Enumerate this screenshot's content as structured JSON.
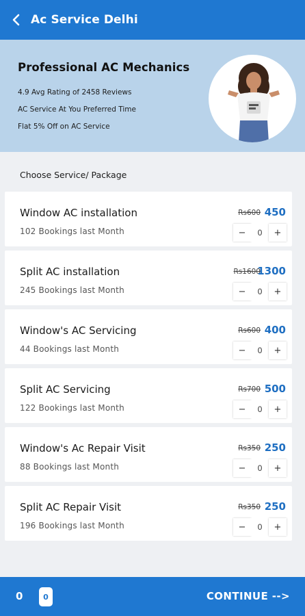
{
  "header": {
    "title": "Ac Service Delhi"
  },
  "hero": {
    "heading": "Professional AC Mechanics",
    "lines": [
      "4.9 Avg Rating of 2458 Reviews",
      "AC Service At You Preferred Time",
      "Flat 5% Off on AC Service"
    ]
  },
  "section_label": "Choose Service/ Package",
  "services": [
    {
      "name": "Window AC installation",
      "bookings": "102  Bookings  last Month",
      "old_price": "Rs600",
      "price": "450",
      "qty": "0"
    },
    {
      "name": "Split AC installation",
      "bookings": "245  Bookings  last Month",
      "old_price": "Rs1600",
      "price": "1300",
      "qty": "0"
    },
    {
      "name": "Window's AC Servicing",
      "bookings": "44  Bookings  last Month",
      "old_price": "Rs600",
      "price": "400",
      "qty": "0"
    },
    {
      "name": "Split AC Servicing",
      "bookings": "122  Bookings  last Month",
      "old_price": "Rs700",
      "price": "500",
      "qty": "0"
    },
    {
      "name": "Window's Ac Repair  Visit",
      "bookings": "88  Bookings  last Month",
      "old_price": "Rs350",
      "price": "250",
      "qty": "0"
    },
    {
      "name": "Split AC Repair Visit",
      "bookings": "196  Bookings  last Month",
      "old_price": "Rs350",
      "price": "250",
      "qty": "0"
    }
  ],
  "stepper": {
    "minus": "−",
    "plus": "+"
  },
  "footer": {
    "count": "0",
    "badge": "0",
    "continue_label": "CONTINUE -->"
  },
  "colors": {
    "primary": "#1f78d1",
    "hero_bg": "#b9d3ea",
    "price": "#1f6fc2"
  },
  "icons": {
    "back": "back-arrow-icon",
    "avatar": "woman-avatar-icon"
  }
}
